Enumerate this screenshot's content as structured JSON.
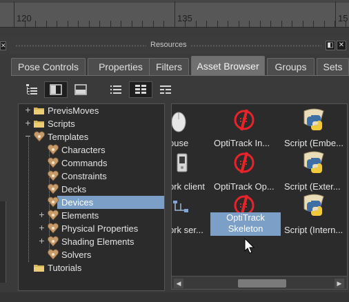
{
  "ruler": {
    "labels": [
      "120",
      "135",
      "15"
    ]
  },
  "panel": {
    "title": "Resources",
    "close": "✕",
    "restore": "◧"
  },
  "tabs": [
    {
      "label": "Pose Controls",
      "active": false
    },
    {
      "label": "Properties",
      "active": false
    },
    {
      "label": "Filters",
      "active": false
    },
    {
      "label": "Asset Browser",
      "active": true
    },
    {
      "label": "Groups",
      "active": false
    },
    {
      "label": "Sets",
      "active": false
    }
  ],
  "toolbar": [
    "tree-view-icon",
    "split-vertical-icon",
    "split-horizontal-icon",
    "list-view-icon",
    "icon-grid-view-icon",
    "detail-view-icon"
  ],
  "tree": [
    {
      "label": "PrevisMoves",
      "kind": "folder",
      "expander": "+",
      "level": 0
    },
    {
      "label": "Scripts",
      "kind": "folder",
      "expander": "+",
      "level": 0
    },
    {
      "label": "Templates",
      "kind": "template",
      "expander": "−",
      "level": 0
    },
    {
      "label": "Characters",
      "kind": "template",
      "expander": "",
      "level": 1
    },
    {
      "label": "Commands",
      "kind": "template",
      "expander": "",
      "level": 1
    },
    {
      "label": "Constraints",
      "kind": "template",
      "expander": "",
      "level": 1
    },
    {
      "label": "Decks",
      "kind": "template",
      "expander": "",
      "level": 1
    },
    {
      "label": "Devices",
      "kind": "template",
      "expander": "",
      "level": 1,
      "selected": true
    },
    {
      "label": "Elements",
      "kind": "template",
      "expander": "+",
      "level": 1
    },
    {
      "label": "Physical Properties",
      "kind": "template",
      "expander": "+",
      "level": 1
    },
    {
      "label": "Shading Elements",
      "kind": "template",
      "expander": "+",
      "level": 1
    },
    {
      "label": "Solvers",
      "kind": "template",
      "expander": "",
      "level": 1
    },
    {
      "label": "Tutorials",
      "kind": "folder",
      "expander": "",
      "level": 0
    }
  ],
  "assets": [
    {
      "label": "ouse",
      "icon": "mouse-icon"
    },
    {
      "label": "OptiTrack In...",
      "icon": "optitrack-icon"
    },
    {
      "label": "Script (Embe...",
      "icon": "python-script-icon"
    },
    {
      "label": "ork client",
      "icon": "network-client-icon"
    },
    {
      "label": "OptiTrack Op...",
      "icon": "optitrack-icon"
    },
    {
      "label": "Script (Exter...",
      "icon": "python-script-icon"
    },
    {
      "label": "ork ser...",
      "icon": "network-server-icon"
    },
    {
      "label": "OptiTrack Skeleton",
      "line1": "OptiTrack",
      "line2": "Skeleton",
      "icon": "optitrack-icon",
      "selected": true
    },
    {
      "label": "Script (Intern...",
      "icon": "python-script-icon"
    }
  ],
  "colors": {
    "selection": "#7c9fc8",
    "optitrack": "#e8242a",
    "python_blue": "#3d6fa5",
    "python_yellow": "#f2c93b"
  }
}
